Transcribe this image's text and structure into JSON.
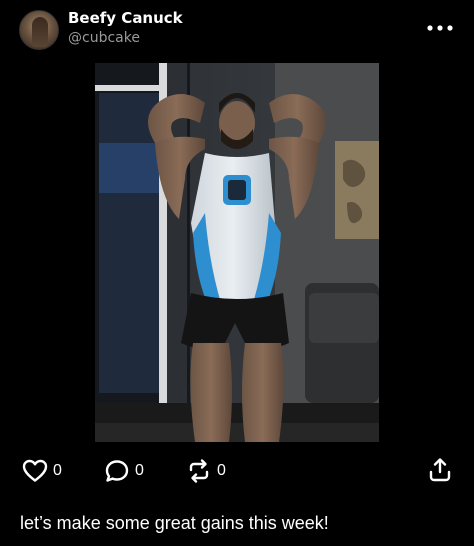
{
  "post": {
    "author": {
      "display_name": "Beefy Canuck",
      "handle": "@cubcake"
    },
    "more_icon": "ellipsis-icon",
    "image_alt": "",
    "actions": {
      "like": {
        "icon": "heart-icon",
        "count": "0"
      },
      "reply": {
        "icon": "chat-bubble-icon",
        "count": "0"
      },
      "repost": {
        "icon": "repost-icon",
        "count": "0"
      },
      "share": {
        "icon": "share-upload-icon"
      }
    },
    "caption": "let’s make some great gains this week!"
  },
  "colors": {
    "background": "#000000",
    "text": "#ffffff",
    "muted": "#9a9a9a",
    "singlet_blue": "#2e8fd0"
  }
}
